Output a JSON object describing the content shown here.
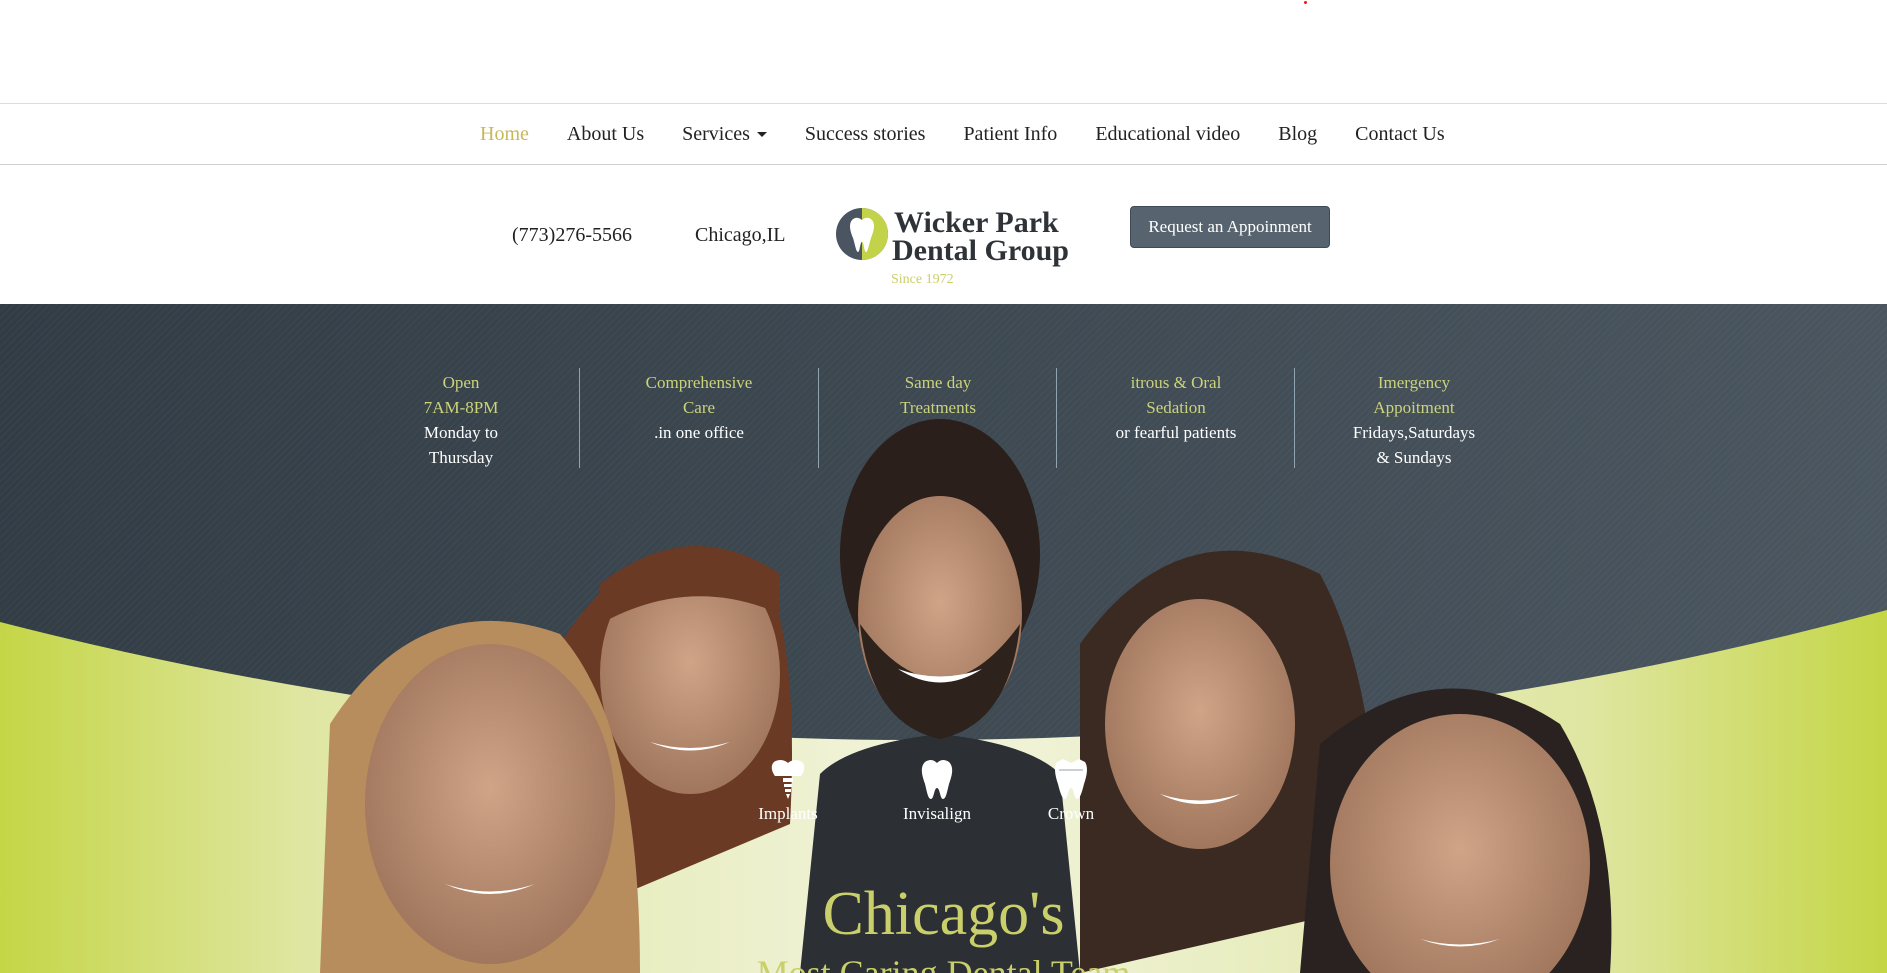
{
  "nav": {
    "items": [
      {
        "label": "Home",
        "active": true
      },
      {
        "label": "About Us"
      },
      {
        "label": "Services",
        "dropdown": true
      },
      {
        "label": "Success stories"
      },
      {
        "label": "Patient Info"
      },
      {
        "label": "Educational video"
      },
      {
        "label": "Blog"
      },
      {
        "label": "Contact Us"
      }
    ]
  },
  "info": {
    "phone": "(773)276-5566",
    "city": "Chicago,IL",
    "logo": {
      "line1": "Wicker Park",
      "line2": "Dental Group",
      "since": "Since 1972"
    },
    "request_button": "Request an Appoinment"
  },
  "features": [
    {
      "highlight": [
        "Open",
        "7AM-8PM"
      ],
      "detail": [
        "Monday to",
        "Thursday"
      ]
    },
    {
      "highlight": [
        "Comprehensive",
        "Care"
      ],
      "detail": [
        ".in one office"
      ]
    },
    {
      "highlight": [
        "Same day",
        "Treatments"
      ],
      "detail": []
    },
    {
      "highlight": [
        "itrous & Oral",
        "Sedation"
      ],
      "detail": [
        "or fearful patients"
      ]
    },
    {
      "highlight": [
        "Imergency",
        "Appoitment"
      ],
      "detail": [
        "Fridays,Saturdays",
        "& Sundays"
      ]
    }
  ],
  "services": [
    {
      "label": "Implants",
      "icon": "implant-tooth-icon"
    },
    {
      "label": "Invisalign",
      "icon": "tooth-icon"
    },
    {
      "label": "Crown",
      "icon": "crown-tooth-icon"
    }
  ],
  "headline": {
    "line1": "Chicago's",
    "line2": "Most Caring Dental Team"
  },
  "colors": {
    "accent_yellow": "#c9cf6a",
    "nav_active": "#c7b85a",
    "hero_dark": "#3d4851",
    "lime": "#c5d84a",
    "button": "#57646f"
  }
}
